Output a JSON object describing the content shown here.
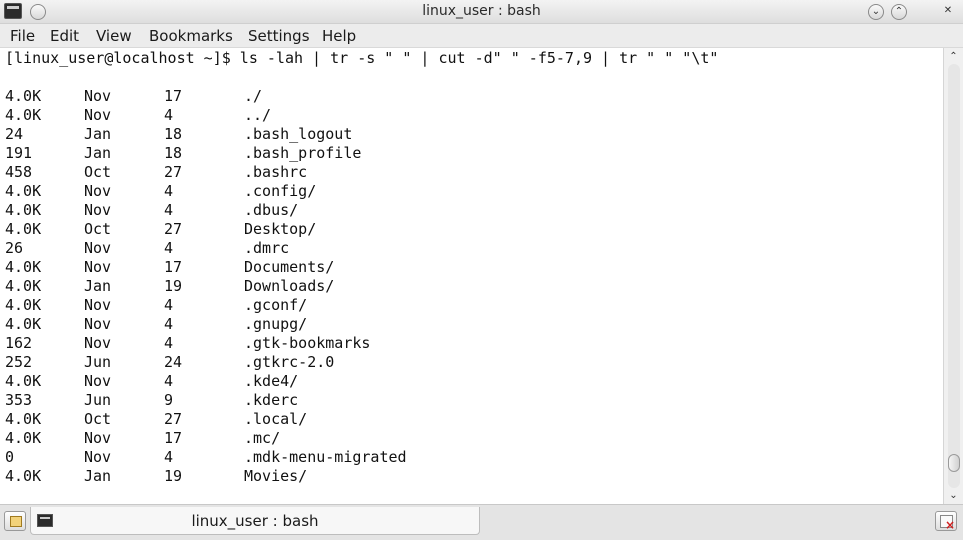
{
  "window": {
    "title": "linux_user : bash",
    "btn_minimize": "⌄",
    "btn_maximize": "⌃",
    "btn_close": "✕"
  },
  "menu": {
    "items": [
      "File",
      "Edit",
      "View",
      "Bookmarks",
      "Settings",
      "Help"
    ]
  },
  "terminal": {
    "prompt": "[linux_user@localhost ~]$ ls -lah | tr -s \" \" | cut -d\" \" -f5-7,9 | tr \" \" \"\\t\"",
    "rows": [
      [
        "4.0K",
        "Nov",
        "17",
        "./"
      ],
      [
        "4.0K",
        "Nov",
        "4",
        "../"
      ],
      [
        "24",
        "Jan",
        "18",
        ".bash_logout"
      ],
      [
        "191",
        "Jan",
        "18",
        ".bash_profile"
      ],
      [
        "458",
        "Oct",
        "27",
        ".bashrc"
      ],
      [
        "4.0K",
        "Nov",
        "4",
        ".config/"
      ],
      [
        "4.0K",
        "Nov",
        "4",
        ".dbus/"
      ],
      [
        "4.0K",
        "Oct",
        "27",
        "Desktop/"
      ],
      [
        "26",
        "Nov",
        "4",
        ".dmrc"
      ],
      [
        "4.0K",
        "Nov",
        "17",
        "Documents/"
      ],
      [
        "4.0K",
        "Jan",
        "19",
        "Downloads/"
      ],
      [
        "4.0K",
        "Nov",
        "4",
        ".gconf/"
      ],
      [
        "4.0K",
        "Nov",
        "4",
        ".gnupg/"
      ],
      [
        "162",
        "Nov",
        "4",
        ".gtk-bookmarks"
      ],
      [
        "252",
        "Jun",
        "24",
        ".gtkrc-2.0"
      ],
      [
        "4.0K",
        "Nov",
        "4",
        ".kde4/"
      ],
      [
        "353",
        "Jun",
        "9",
        ".kderc"
      ],
      [
        "4.0K",
        "Oct",
        "27",
        ".local/"
      ],
      [
        "4.0K",
        "Nov",
        "17",
        ".mc/"
      ],
      [
        "0",
        "Nov",
        "4",
        ".mdk-menu-migrated"
      ],
      [
        "4.0K",
        "Jan",
        "19",
        "Movies/"
      ]
    ]
  },
  "scrollbar": {
    "up_arrow": "⌃",
    "down_arrow": "⌄",
    "thumb_position": 0.96,
    "thumb_size": 0.04
  },
  "tabs": {
    "items": [
      {
        "label": "linux_user : bash"
      }
    ]
  }
}
